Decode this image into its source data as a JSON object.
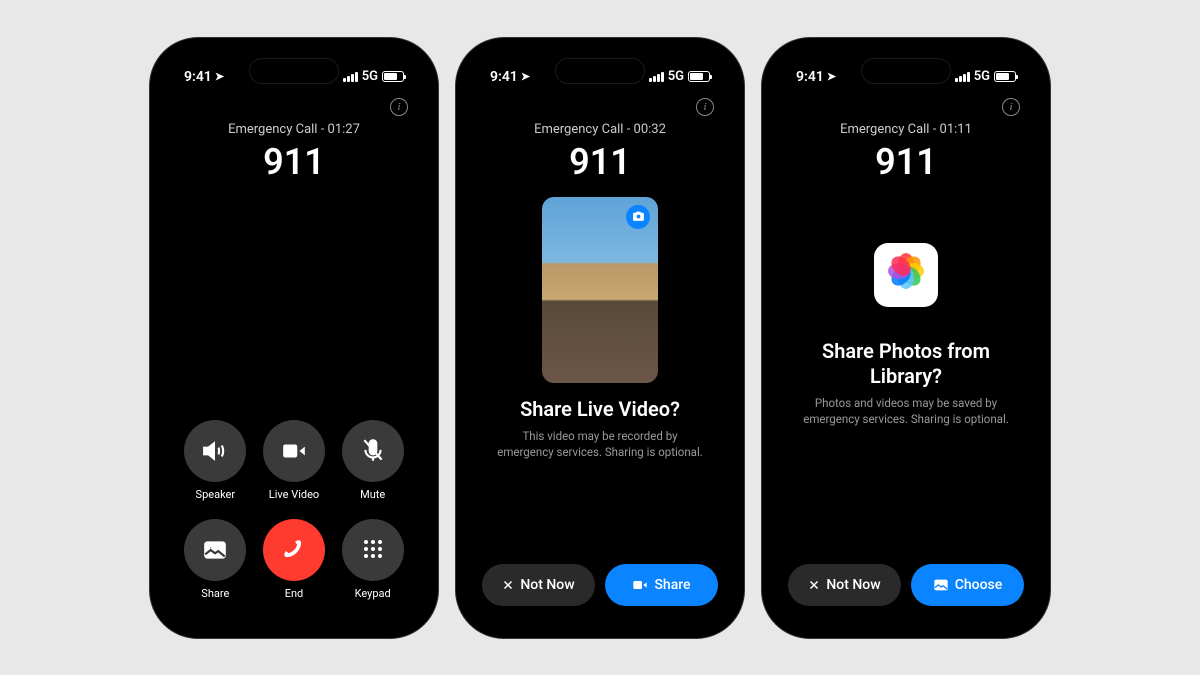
{
  "phones": [
    {
      "status": {
        "time": "9:41",
        "network": "5G"
      },
      "header": {
        "status": "Emergency Call - 01:27",
        "number": "911"
      },
      "controls": [
        {
          "label": "Speaker",
          "icon": "speaker-icon"
        },
        {
          "label": "Live Video",
          "icon": "video-icon"
        },
        {
          "label": "Mute",
          "icon": "mute-icon"
        },
        {
          "label": "Share",
          "icon": "share-icon"
        },
        {
          "label": "End",
          "icon": "end-call-icon"
        },
        {
          "label": "Keypad",
          "icon": "keypad-icon"
        }
      ]
    },
    {
      "status": {
        "time": "9:41",
        "network": "5G"
      },
      "header": {
        "status": "Emergency Call - 00:32",
        "number": "911"
      },
      "prompt": {
        "title": "Share Live Video?",
        "subtitle": "This video may be recorded by emergency services. Sharing is optional."
      },
      "buttons": {
        "secondary": "Not Now",
        "primary": "Share"
      }
    },
    {
      "status": {
        "time": "9:41",
        "network": "5G"
      },
      "header": {
        "status": "Emergency Call - 01:11",
        "number": "911"
      },
      "prompt": {
        "title": "Share Photos from Library?",
        "subtitle": "Photos and videos may be saved by emergency services. Sharing is optional."
      },
      "buttons": {
        "secondary": "Not Now",
        "primary": "Choose"
      }
    }
  ]
}
